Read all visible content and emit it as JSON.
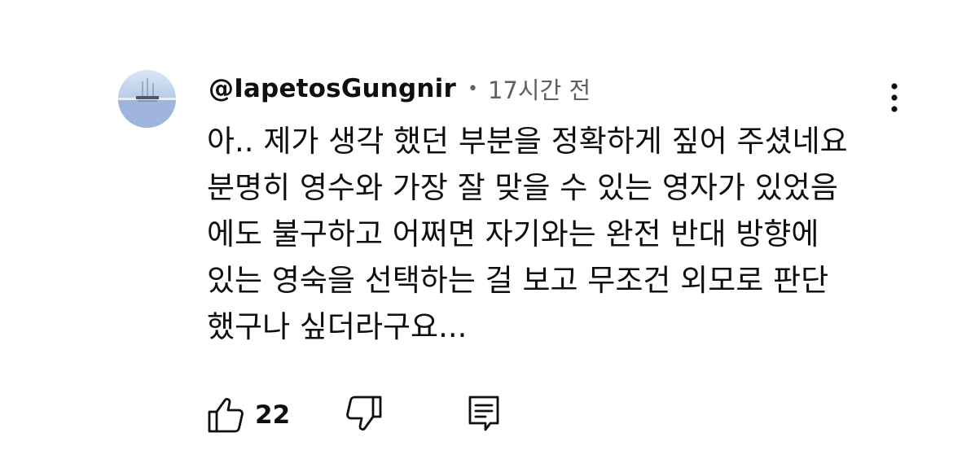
{
  "comment": {
    "author": "@IapetosGungnir",
    "separator": "•",
    "time": "17시간 전",
    "text_lines": [
      "아.. 제가 생각 했던 부분을 정확하게 짚어 주셨네요",
      "분명히 영수와 가장 잘 맞을 수 있는 영자가 있었음",
      "에도 불구하고 어쩌면 자기와는 완전 반대 방향에",
      "있는 영숙을 선택하는 걸 보고 무조건 외모로 판단",
      "했구나 싶더라구요..."
    ],
    "like_count": "22"
  },
  "icons": {
    "avatar": "avatar-image",
    "more": "more-vertical-icon",
    "like": "thumbs-up-icon",
    "dislike": "thumbs-down-icon",
    "reply": "comment-reply-icon"
  },
  "colors": {
    "text": "#0f0f0f",
    "secondary": "#606060",
    "background": "#ffffff"
  }
}
